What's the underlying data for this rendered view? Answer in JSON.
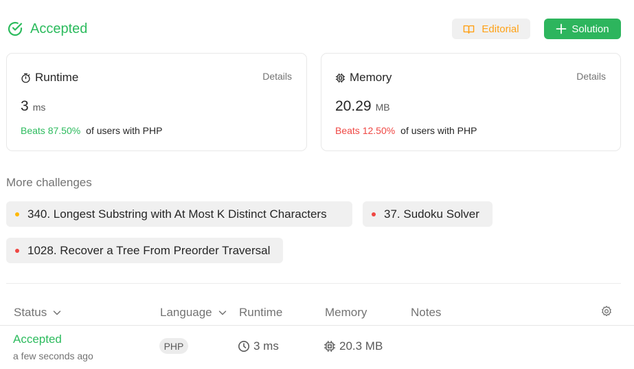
{
  "header": {
    "status": "Accepted",
    "editorial_label": "Editorial",
    "solution_label": "Solution"
  },
  "runtime_card": {
    "title": "Runtime",
    "details": "Details",
    "value": "3",
    "unit": "ms",
    "beats": "Beats 87.50%",
    "beats_rest": "of users with PHP"
  },
  "memory_card": {
    "title": "Memory",
    "details": "Details",
    "value": "20.29",
    "unit": "MB",
    "beats": "Beats 12.50%",
    "beats_rest": "of users with PHP"
  },
  "more_challenges": {
    "label": "More challenges",
    "items": [
      {
        "title": "340. Longest Substring with At Most K Distinct Characters",
        "difficulty_color": "#ffb800"
      },
      {
        "title": "37. Sudoku Solver",
        "difficulty_color": "#ef4743"
      },
      {
        "title": "1028. Recover a Tree From Preorder Traversal",
        "difficulty_color": "#ef4743"
      }
    ]
  },
  "table": {
    "headers": {
      "status": "Status",
      "language": "Language",
      "runtime": "Runtime",
      "memory": "Memory",
      "notes": "Notes"
    },
    "rows": [
      {
        "status": "Accepted",
        "time": "a few seconds ago",
        "language": "PHP",
        "runtime": "3 ms",
        "memory": "20.3 MB"
      }
    ]
  },
  "colors": {
    "accent_green": "#2cbb5d",
    "editorial_orange": "#ffa116",
    "bad_red": "#ef4743"
  },
  "icons": [
    "check-circle-icon",
    "book-icon",
    "plus-icon",
    "stopwatch-icon",
    "chip-icon",
    "chevron-down-icon",
    "gear-icon",
    "clock-icon"
  ]
}
